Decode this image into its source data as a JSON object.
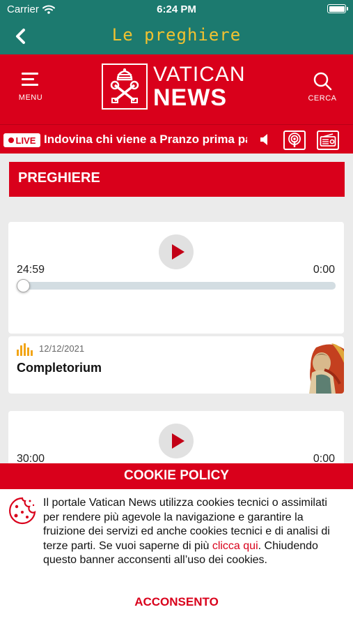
{
  "status_bar": {
    "carrier": "Carrier",
    "time": "6:24 PM"
  },
  "nav": {
    "title": "Le preghiere"
  },
  "header": {
    "menu_label": "MENU",
    "search_label": "CERCA",
    "logo_line1": "VATICAN",
    "logo_line2": "NEWS",
    "accent": "#d9001b"
  },
  "live": {
    "badge": "LIVE",
    "ticker": "Indovina chi viene a Pranzo prima pa"
  },
  "section": {
    "title": "PREGHIERE"
  },
  "episodes": [
    {
      "elapsed": "24:59",
      "remaining": "0:00",
      "progress": 0,
      "date": "12/12/2021",
      "title": "Completorium"
    },
    {
      "elapsed": "30:00",
      "remaining": "0:00",
      "progress": 0
    }
  ],
  "cookie": {
    "title": "COOKIE POLICY",
    "text_before": "Il portale Vatican News utilizza cookies tecnici o assimilati per rendere più agevole la navigazione e garantire la fruizione dei servizi ed anche cookies tecnici e di analisi di terze parti. Se vuoi saperne di più ",
    "link": "clicca qui",
    "text_after": ". Chiudendo questo banner acconsenti all’uso dei cookies.",
    "accept": "ACCONSENTO"
  }
}
